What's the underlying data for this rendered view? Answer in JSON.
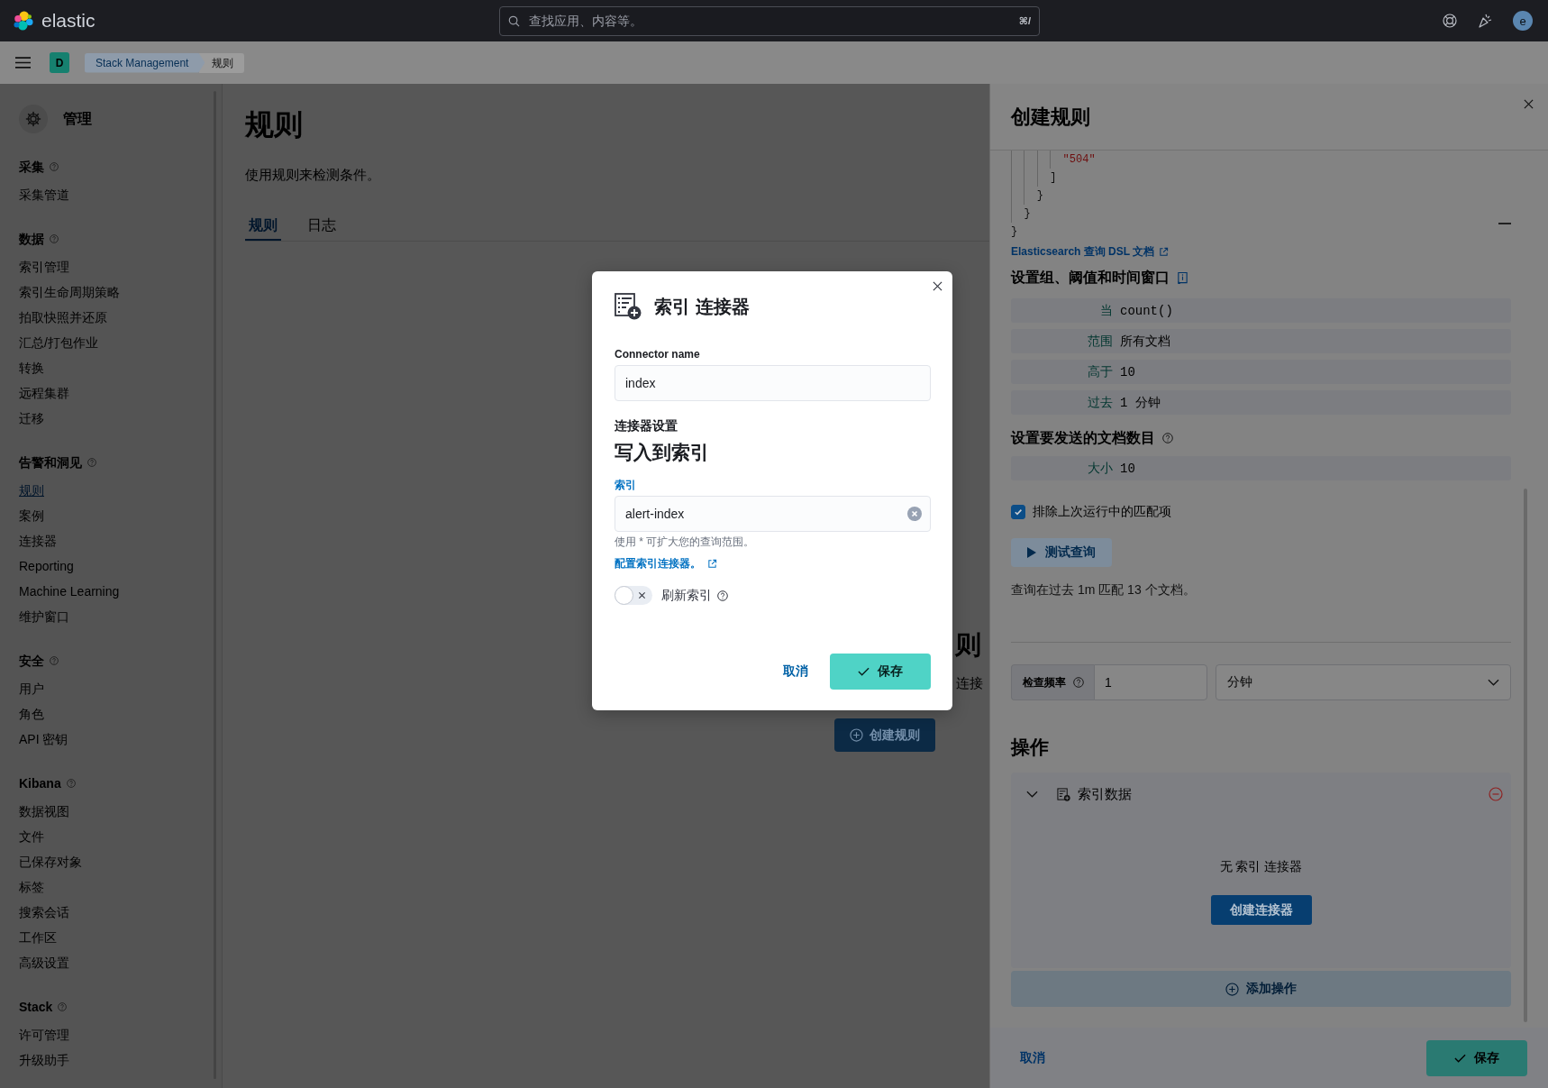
{
  "top_bar": {
    "logo": "elastic",
    "search": {
      "placeholder": "查找应用、内容等。",
      "shortcut": "⌘/"
    },
    "avatar": "e"
  },
  "breadcrumb_bar": {
    "space": "D",
    "breadcrumbs": [
      {
        "label": "Stack Management",
        "selected": false
      },
      {
        "label": "规则",
        "selected": true
      }
    ]
  },
  "sidebar": {
    "title": "管理",
    "sections": [
      {
        "title": "采集",
        "items": [
          {
            "label": "采集管道",
            "selected": false
          }
        ]
      },
      {
        "title": "数据",
        "items": [
          {
            "label": "索引管理",
            "selected": false
          },
          {
            "label": "索引生命周期策略",
            "selected": false
          },
          {
            "label": "拍取快照并还原",
            "selected": false
          },
          {
            "label": "汇总/打包作业",
            "selected": false
          },
          {
            "label": "转换",
            "selected": false
          },
          {
            "label": "远程集群",
            "selected": false
          },
          {
            "label": "迁移",
            "selected": false
          }
        ]
      },
      {
        "title": "告警和洞见",
        "items": [
          {
            "label": "规则",
            "selected": true
          },
          {
            "label": "案例",
            "selected": false
          },
          {
            "label": "连接器",
            "selected": false
          },
          {
            "label": "Reporting",
            "selected": false
          },
          {
            "label": "Machine Learning",
            "selected": false
          },
          {
            "label": "维护窗口",
            "selected": false
          }
        ]
      },
      {
        "title": "安全",
        "items": [
          {
            "label": "用户",
            "selected": false
          },
          {
            "label": "角色",
            "selected": false
          },
          {
            "label": "API 密钥",
            "selected": false
          }
        ]
      },
      {
        "title": "Kibana",
        "items": [
          {
            "label": "数据视图",
            "selected": false
          },
          {
            "label": "文件",
            "selected": false
          },
          {
            "label": "已保存对象",
            "selected": false
          },
          {
            "label": "标签",
            "selected": false
          },
          {
            "label": "搜索会话",
            "selected": false
          },
          {
            "label": "工作区",
            "selected": false
          },
          {
            "label": "高级设置",
            "selected": false
          }
        ]
      },
      {
        "title": "Stack",
        "items": [
          {
            "label": "许可管理",
            "selected": false
          },
          {
            "label": "升级助手",
            "selected": false
          }
        ]
      }
    ]
  },
  "page": {
    "title": "规则",
    "description": "使用规则来检测条件。",
    "tabs": [
      {
        "label": "规则",
        "selected": true
      },
      {
        "label": "日志",
        "selected": false
      }
    ],
    "empty_prompt": {
      "title": "则",
      "body": "连接",
      "button": "创建规则"
    }
  },
  "flyout": {
    "title": "创建规则",
    "code_lines": [
      {
        "kind": "string",
        "text": "        \"504\""
      },
      {
        "kind": "punct",
        "text": "      ]"
      },
      {
        "kind": "punct",
        "text": "    }"
      },
      {
        "kind": "punct",
        "text": "  }"
      },
      {
        "kind": "punct",
        "text": "}"
      }
    ],
    "docs_link": "Elasticsearch 查询 DSL 文档",
    "threshold": {
      "title": "设置组、阈值和时间窗口",
      "rows": [
        {
          "label": "当",
          "value": "count()"
        },
        {
          "label": "范围",
          "value": "所有文档"
        },
        {
          "label": "高于",
          "value": "10"
        },
        {
          "label": "过去",
          "value": "1 分钟"
        }
      ]
    },
    "size": {
      "title": "设置要发送的文档数目",
      "rows": [
        {
          "label": "大小",
          "value": "10"
        }
      ]
    },
    "exclude": {
      "label": "排除上次运行中的匹配项",
      "checked": true
    },
    "test_button": "测试查询",
    "test_result": "查询在过去 1m 匹配 13 个文档。",
    "interval": {
      "label": "检查频率",
      "value": "1",
      "unit": "分钟"
    },
    "actions": {
      "title": "操作",
      "items": [
        {
          "name": "索引数据",
          "expanded": true,
          "empty_text": "无 索引 连接器",
          "button": "创建连接器"
        }
      ],
      "add_button": "添加操作"
    },
    "footer": {
      "cancel": "取消",
      "save": "保存"
    }
  },
  "modal": {
    "title": "索引 连接器",
    "name_field": {
      "label": "Connector name",
      "value": "index"
    },
    "settings_label": "连接器设置",
    "section_title": "写入到索引",
    "index_field": {
      "label": "索引",
      "value": "alert-index",
      "focused": true,
      "help": "使用 * 可扩大您的查询范围。"
    },
    "config_link": "配置索引连接器。",
    "refresh": {
      "label": "刷新索引",
      "on": false
    },
    "cancel": "取消",
    "save": "保存"
  }
}
